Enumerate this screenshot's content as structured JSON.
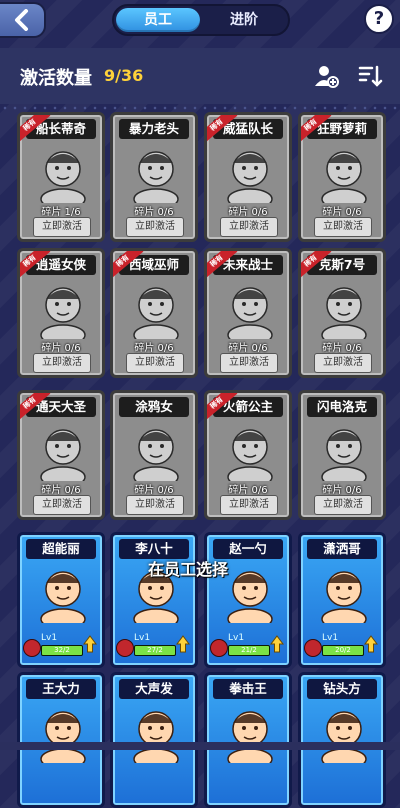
{
  "tabs": {
    "staff": "员工",
    "advance": "进阶"
  },
  "help": "?",
  "header": {
    "label": "激活数量",
    "count": "9/36"
  },
  "locked_cards": [
    {
      "name": "船长蒂奇",
      "fragments": "碎片 1/6",
      "button": "立即激活",
      "ribbon": "稀有"
    },
    {
      "name": "暴力老头",
      "fragments": "碎片 0/6",
      "button": "立即激活",
      "ribbon": ""
    },
    {
      "name": "威猛队长",
      "fragments": "碎片 0/6",
      "button": "立即激活",
      "ribbon": "稀有"
    },
    {
      "name": "狂野萝莉",
      "fragments": "碎片 0/6",
      "button": "立即激活",
      "ribbon": "稀有"
    },
    {
      "name": "逍遥女侠",
      "fragments": "碎片 0/6",
      "button": "立即激活",
      "ribbon": "稀有"
    },
    {
      "name": "西域巫师",
      "fragments": "碎片 0/6",
      "button": "立即激活",
      "ribbon": "稀有"
    },
    {
      "name": "未来战士",
      "fragments": "碎片 0/6",
      "button": "立即激活",
      "ribbon": "稀有"
    },
    {
      "name": "克斯7号",
      "fragments": "碎片 0/6",
      "button": "立即激活",
      "ribbon": "稀有"
    },
    {
      "name": "通天大圣",
      "fragments": "碎片 0/6",
      "button": "立即激活",
      "ribbon": "稀有"
    },
    {
      "name": "涂鸦女",
      "fragments": "碎片 0/6",
      "button": "立即激活",
      "ribbon": ""
    },
    {
      "name": "火箭公主",
      "fragments": "碎片 0/6",
      "button": "立即激活",
      "ribbon": "稀有"
    },
    {
      "name": "闪电洛克",
      "fragments": "碎片 0/6",
      "button": "立即激活",
      "ribbon": ""
    }
  ],
  "active_cards": [
    {
      "name": "超能丽",
      "level": "Lv1",
      "progress": "32/2",
      "progress_fraction": 1.0
    },
    {
      "name": "李八十",
      "level": "Lv1",
      "progress": "27/2",
      "progress_fraction": 1.0
    },
    {
      "name": "赵一勺",
      "level": "Lv1",
      "progress": "21/2",
      "progress_fraction": 1.0
    },
    {
      "name": "潇洒哥",
      "level": "Lv1",
      "progress": "20/2",
      "progress_fraction": 1.0
    }
  ],
  "bottom_cards": [
    {
      "name": "王大力"
    },
    {
      "name": "大声发"
    },
    {
      "name": "拳击王"
    },
    {
      "name": "钻头方"
    }
  ],
  "overlay": "在员工选择",
  "colors": {
    "accent_blue": "#2f8fe0",
    "count_yellow": "#ffd23a",
    "rare_red": "#c9222a",
    "progress_green": "#7be246"
  }
}
